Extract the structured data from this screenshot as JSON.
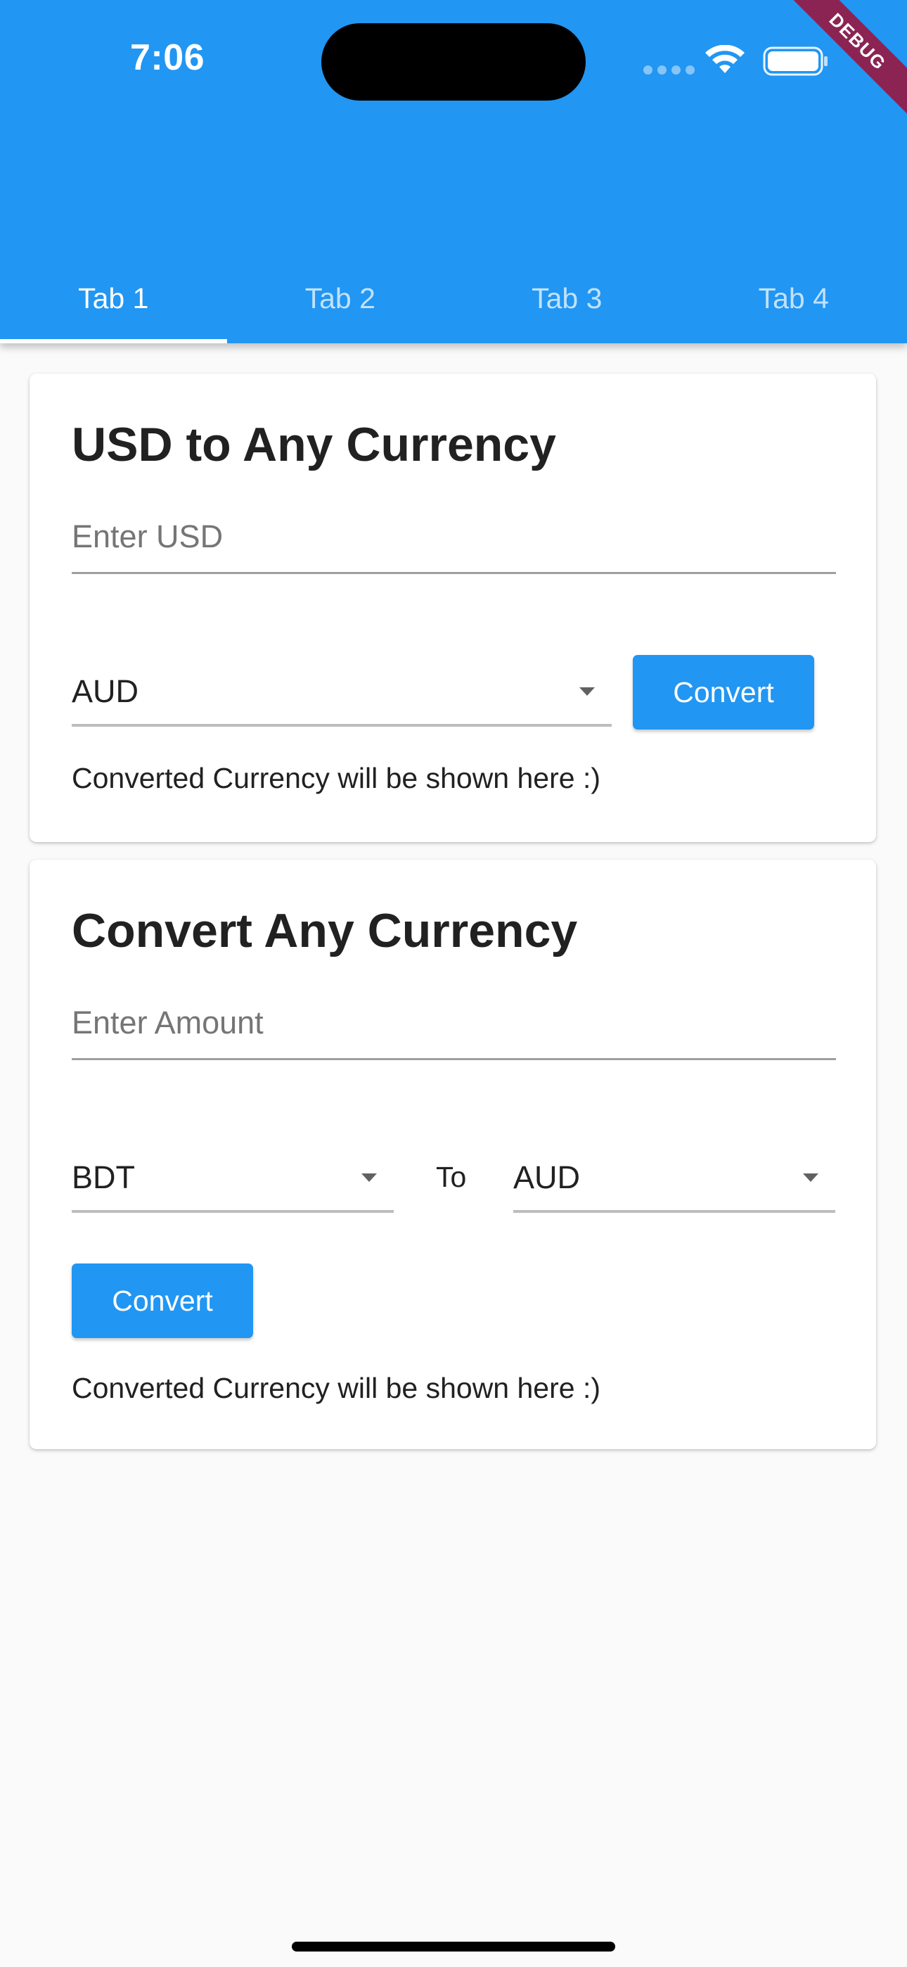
{
  "status_bar": {
    "time": "7:06"
  },
  "debug_banner": "DEBUG",
  "tabs": [
    {
      "label": "Tab 1",
      "active": true
    },
    {
      "label": "Tab 2",
      "active": false
    },
    {
      "label": "Tab 3",
      "active": false
    },
    {
      "label": "Tab 4",
      "active": false
    }
  ],
  "usd_card": {
    "title": "USD to Any Currency",
    "input_placeholder": "Enter USD",
    "input_value": "",
    "currency_selected": "AUD",
    "convert_label": "Convert",
    "result_text": "Converted Currency will be shown here :)"
  },
  "any_card": {
    "title": "Convert Any Currency",
    "input_placeholder": "Enter Amount",
    "input_value": "",
    "from_currency": "BDT",
    "to_label": "To",
    "to_currency": "AUD",
    "convert_label": "Convert",
    "result_text": "Converted Currency will be shown here :)"
  },
  "colors": {
    "primary": "#2196f3",
    "background": "#fafafa",
    "card": "#ffffff",
    "debug_banner": "#8b2452"
  }
}
